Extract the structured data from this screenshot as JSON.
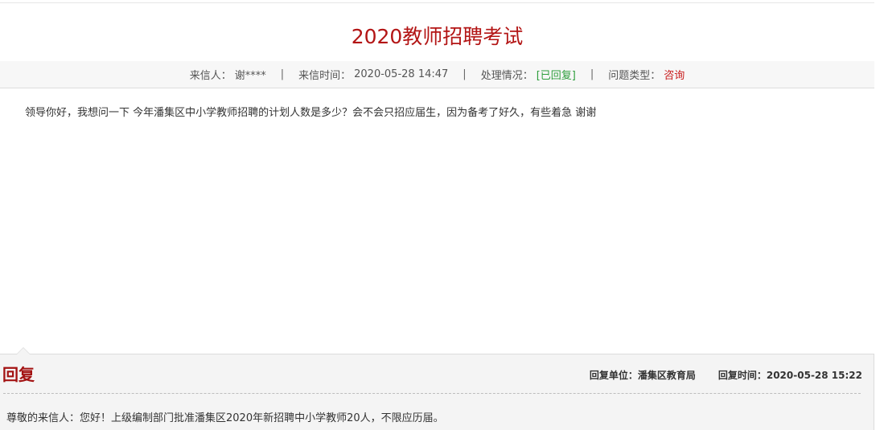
{
  "letter": {
    "title": "2020教师招聘考试",
    "meta": {
      "sender_label": "来信人：",
      "sender_value": "谢****",
      "time_label": "来信时间：",
      "time_value": "2020-05-28 14:47",
      "status_label": "处理情况：",
      "status_value": "[已回复]",
      "type_label": "问题类型：",
      "type_value": "咨询",
      "separator": "|"
    },
    "body": "领导你好，我想问一下 今年潘集区中小学教师招聘的计划人数是多少？会不会只招应届生，因为备考了好久，有些着急 谢谢"
  },
  "reply": {
    "heading": "回复",
    "unit_label": "回复单位：",
    "unit_value": "潘集区教育局",
    "time_label": "回复时间：",
    "time_value": "2020-05-28 15:22",
    "body": "尊敬的来信人：您好！上级编制部门批准潘集区2020年新招聘中小学教师20人，不限应历届。"
  },
  "colors": {
    "title": "#b31515",
    "status": "#2e9e3c",
    "type": "#c81d1d",
    "reply_heading": "#a31212"
  }
}
